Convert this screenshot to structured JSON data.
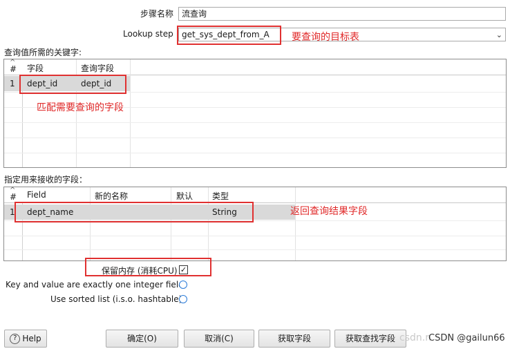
{
  "form": {
    "step_name_label": "步骤名称",
    "step_name_value": "流查询",
    "lookup_step_label": "Lookup step",
    "lookup_step_value": "get_sys_dept_from_A"
  },
  "annotations": {
    "target_table": "要查询的目标表",
    "match_fields": "匹配需要查询的字段",
    "return_fields": "返回查询结果字段"
  },
  "keys_section": {
    "title": "查询值所需的关键字:",
    "sort_indicator": "^",
    "columns": [
      "#",
      "字段",
      "查询字段"
    ],
    "rows": [
      {
        "num": "1",
        "field": "dept_id",
        "lookup_field": "dept_id"
      }
    ]
  },
  "receive_section": {
    "title": "指定用来接收的字段：",
    "sort_indicator": "^",
    "columns": [
      "#",
      "Field",
      "新的名称",
      "默认",
      "类型"
    ],
    "rows": [
      {
        "num": "1",
        "field": "dept_name",
        "new_name": "",
        "default": "",
        "type": "String"
      }
    ]
  },
  "options": {
    "preserve_memory_label": "保留内存 (消耗CPU)",
    "preserve_memory_checked": true,
    "check_glyph": "✓",
    "integer_key_label": "Key and value are exactly one integer field",
    "sorted_list_label": "Use sorted list (i.s.o. hashtable)"
  },
  "buttons": {
    "help": "Help",
    "help_icon": "?",
    "ok": "确定(O)",
    "cancel": "取消(C)",
    "get_fields": "获取字段",
    "get_lookup_fields": "获取查找字段"
  },
  "watermark": "CSDN @gailun66",
  "watermark_faint": "csdn.n"
}
